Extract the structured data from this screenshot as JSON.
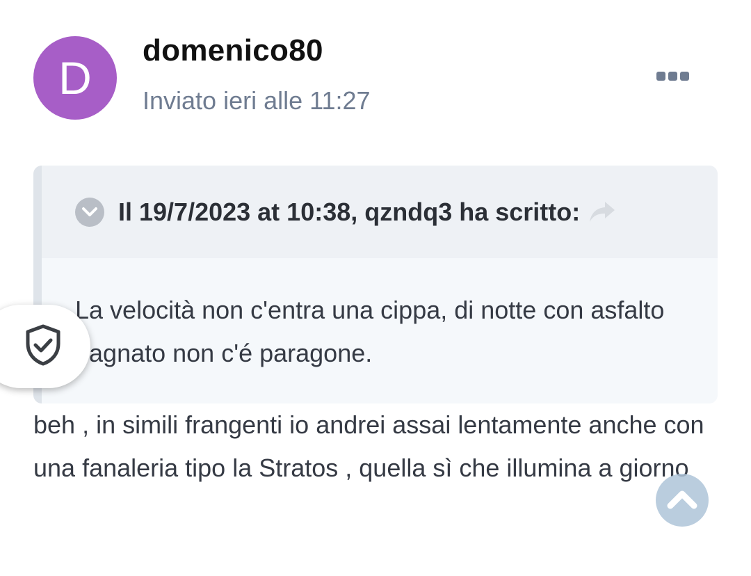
{
  "post": {
    "avatar_letter": "D",
    "avatar_color": "#a75ec7",
    "author": "domenico80",
    "timestamp": "Inviato ieri alle 11:27",
    "more_icon": "ellipsis-icon"
  },
  "quote": {
    "citation": "Il 19/7/2023 at 10:38, qzndq3 ha scritto:",
    "toggle_icon": "chevron-down-icon",
    "share_icon": "share-arrow-icon",
    "text": "La velocità non c'entra una cippa, di notte con asfalto bagnato non c'é paragone."
  },
  "reply": {
    "text": "beh , in simili frangenti io andrei assai lentamente anche con una fanaleria tipo la Stratos , quella sì che illumina a giorno"
  },
  "floating": {
    "privacy_icon": "shield-check-icon",
    "scroll_top_icon": "chevron-up-icon"
  }
}
